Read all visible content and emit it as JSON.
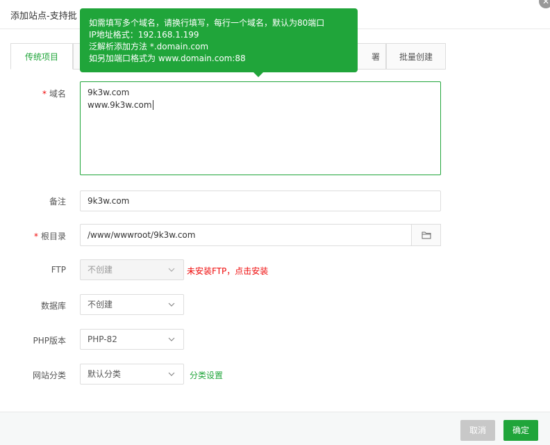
{
  "dialog": {
    "title": "添加站点-支持批",
    "close_icon": "close-icon"
  },
  "tabs": [
    {
      "label": "传统项目",
      "active": true
    },
    {
      "label": "署"
    },
    {
      "label": "批量创建"
    }
  ],
  "tooltip": {
    "line1": "如需填写多个域名，请换行填写，每行一个域名，默认为80端口",
    "line2": "IP地址格式：192.168.1.199",
    "line3": "泛解析添加方法 *.domain.com",
    "line4": "如另加端口格式为 www.domain.com:88"
  },
  "form": {
    "domain": {
      "label": "域名",
      "required_mark": "*",
      "lines": [
        "9k3w.com",
        "www.9k3w.com"
      ]
    },
    "remark": {
      "label": "备注",
      "value": "9k3w.com"
    },
    "root": {
      "label": "根目录",
      "required_mark": "*",
      "value": "/www/wwwroot/9k3w.com",
      "icon": "folder-icon"
    },
    "ftp": {
      "label": "FTP",
      "value": "不创建",
      "warning": "未安装FTP，点击安装"
    },
    "database": {
      "label": "数据库",
      "value": "不创建"
    },
    "php": {
      "label": "PHP版本",
      "value": "PHP-82"
    },
    "category": {
      "label": "网站分类",
      "value": "默认分类",
      "link": "分类设置"
    }
  },
  "footer": {
    "cancel_label": "取消",
    "confirm_label": "确定"
  },
  "colors": {
    "accent": "#20a53a",
    "warning": "#ef0808"
  }
}
